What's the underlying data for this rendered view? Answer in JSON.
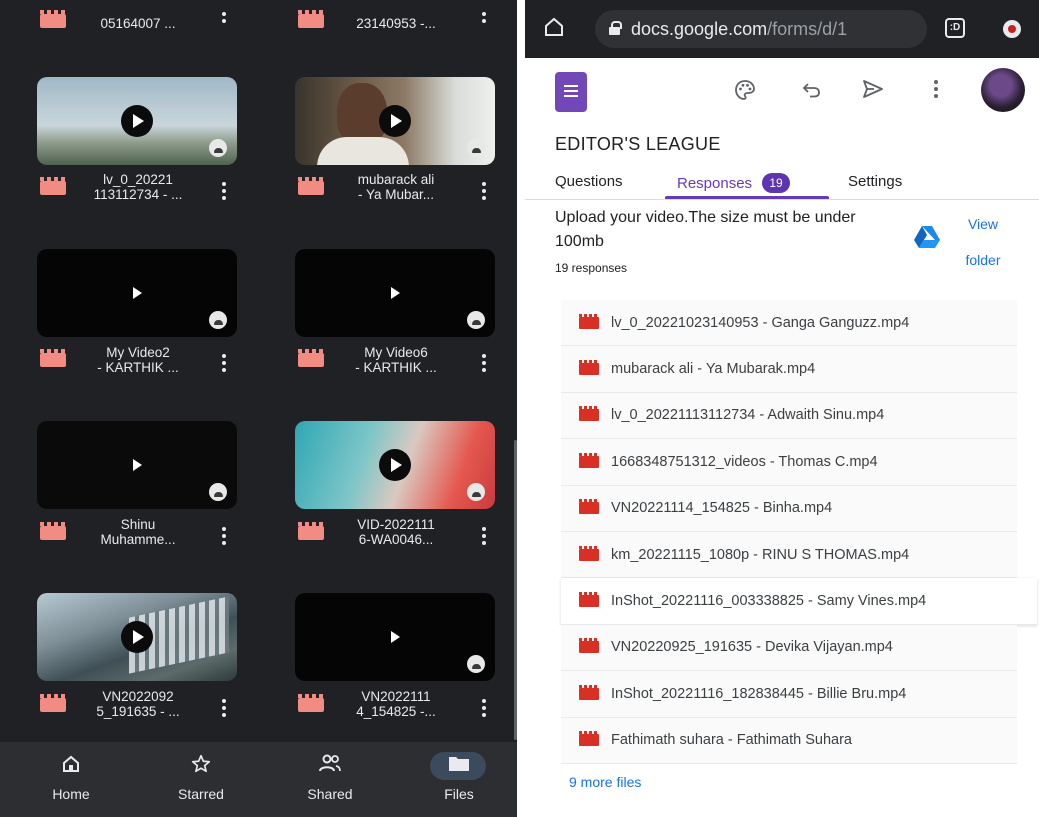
{
  "drive": {
    "top_row": [
      {
        "name": "05164007 ..."
      },
      {
        "name": "23140953 -..."
      }
    ],
    "tiles": [
      {
        "name": "lv_0_20221\n113112734 - ...",
        "thumb": "sky",
        "play": "big"
      },
      {
        "name": "mubarack ali\n- Ya Mubar...",
        "thumb": "person",
        "play": "big"
      },
      {
        "name": "My Video2\n- KARTHIK ...",
        "thumb": "black",
        "play": "small"
      },
      {
        "name": "My Video6\n- KARTHIK ...",
        "thumb": "black",
        "play": "small"
      },
      {
        "name": "Shinu\nMuhamme...",
        "thumb": "black",
        "play": "small"
      },
      {
        "name": "VID-2022111\n6-WA0046...",
        "thumb": "gradient",
        "play": "big"
      },
      {
        "name": "VN2022092\n5_191635 - ...",
        "thumb": "street",
        "play": "big"
      },
      {
        "name": "VN2022111\n4_154825 -...",
        "thumb": "black",
        "play": "small"
      }
    ],
    "nav": [
      {
        "label": "Home",
        "icon": "home-icon"
      },
      {
        "label": "Starred",
        "icon": "star-icon"
      },
      {
        "label": "Shared",
        "icon": "shared-icon"
      },
      {
        "label": "Files",
        "icon": "folder-icon"
      }
    ]
  },
  "browser": {
    "url_host": "docs.google.com",
    "url_path": "/forms/d/1",
    "tabs_count": ":D"
  },
  "form": {
    "title": "EDITOR'S LEAGUE",
    "tabs": {
      "questions": "Questions",
      "responses": "Responses",
      "responses_count": "19",
      "settings": "Settings"
    },
    "question": "Upload your video.The size must be under 100mb",
    "responses_text": "19 responses",
    "view_folder": "View folder",
    "files": [
      "lv_0_20221023140953 - Ganga Ganguzz.mp4",
      "mubarack ali - Ya Mubarak.mp4",
      "lv_0_20221113112734 - Adwaith Sinu.mp4",
      "1668348751312_videos - Thomas C.mp4",
      "VN20221114_154825 - Binha.mp4",
      "km_20221115_1080p - RINU S THOMAS.mp4",
      "InShot_20221116_003338825 - Samy Vines.mp4",
      "VN20220925_191635 - Devika Vijayan.mp4",
      "InShot_20221116_182838445 - Billie Bru.mp4",
      "Fathimath suhara - Fathimath Suhara"
    ],
    "more_files": "9 more files"
  }
}
